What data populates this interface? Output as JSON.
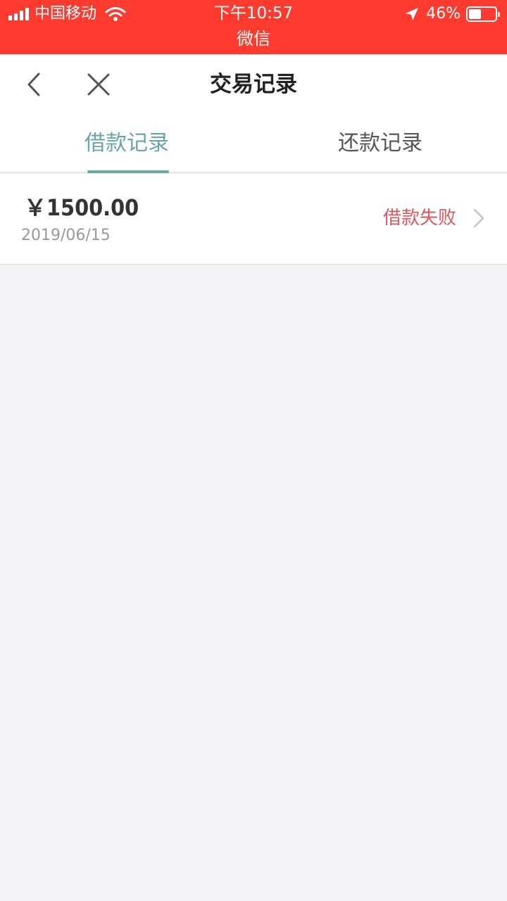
{
  "status_bar": {
    "carrier": "中国移动",
    "time": "下午10:57",
    "app_name": "微信",
    "battery_percent": "46%",
    "battery_level": 0.46,
    "signal_icon": "signal-bars-icon",
    "wifi_icon": "wifi-icon",
    "location_icon": "location-arrow-icon",
    "background_color": "#ff3b30"
  },
  "nav": {
    "title": "交易记录",
    "back_icon": "chevron-left-icon",
    "close_icon": "close-icon"
  },
  "tabs": [
    {
      "label": "借款记录",
      "active": true
    },
    {
      "label": "还款记录",
      "active": false
    }
  ],
  "records": [
    {
      "amount": "￥1500.00",
      "date": "2019/06/15",
      "status": "借款失败",
      "status_color": "#e0555e"
    }
  ],
  "colors": {
    "accent": "#6aa5a8",
    "page_background": "#f3f3f8"
  }
}
